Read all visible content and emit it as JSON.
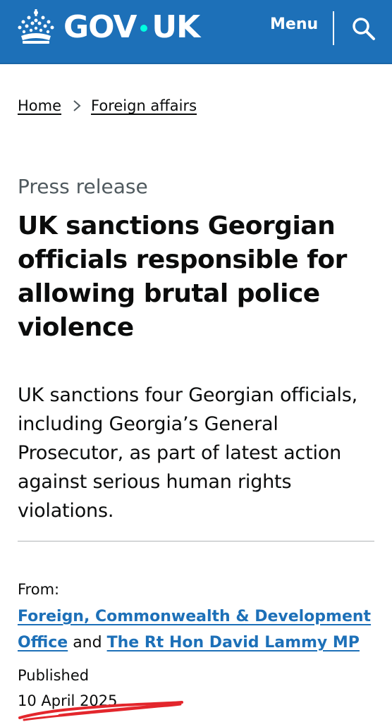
{
  "header": {
    "logo_left": "GOV",
    "logo_right": "UK",
    "menu_label": "Menu",
    "search_icon": "search-icon",
    "crown_icon": "crown-icon",
    "colors": {
      "background": "#1d70b8",
      "text": "#ffffff",
      "dot": "#00ffe0"
    }
  },
  "breadcrumb": {
    "items": [
      {
        "label": "Home"
      },
      {
        "label": "Foreign affairs"
      }
    ],
    "separator_icon": "chevron-right-icon"
  },
  "article": {
    "caption": "Press release",
    "title": "UK sanctions Georgian officials responsible for allowing brutal police violence",
    "lead": "UK sanctions four Georgian officials, including Georgia’s General Prosecutor, as part of latest action against serious human rights violations."
  },
  "metadata": {
    "from_label": "From:",
    "org1": "Foreign, Commonwealth & Development",
    "org1_cont": "Office",
    "conjunction": "and",
    "org2": "The Rt Hon David Lammy MP",
    "published_label": "Published",
    "published_date": "10 April 2025",
    "link_color": "#1d70b8",
    "annotation_color": "#e3262c"
  }
}
